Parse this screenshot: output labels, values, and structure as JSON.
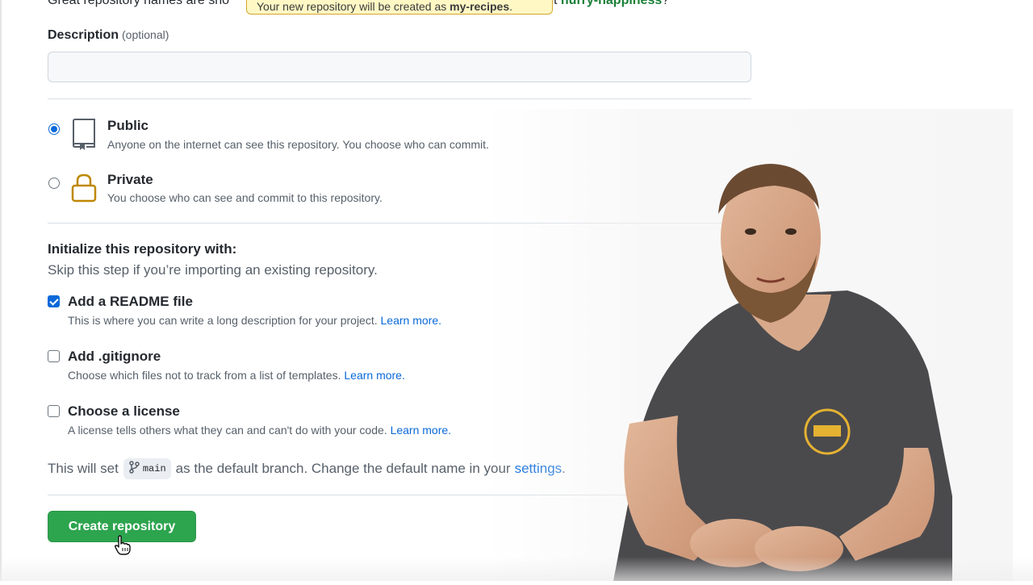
{
  "top": {
    "partial_text": "Great repository names are sho",
    "suffix_prefix": "t ",
    "suffix_name": "hurry-happiness",
    "suffix_end": "?",
    "tooltip_prefix": "Your new repository will be created as ",
    "tooltip_repo": "my-recipes",
    "tooltip_end": "."
  },
  "description": {
    "label": "Description",
    "optional": "(optional)",
    "value": "",
    "placeholder": ""
  },
  "visibility": {
    "options": [
      {
        "title": "Public",
        "desc": "Anyone on the internet can see this repository. You choose who can commit.",
        "selected": true,
        "icon": "repo-icon"
      },
      {
        "title": "Private",
        "desc": "You choose who can see and commit to this repository.",
        "selected": false,
        "icon": "lock-icon"
      }
    ]
  },
  "initialize": {
    "title": "Initialize this repository with:",
    "subtitle": "Skip this step if you’re importing an existing repository.",
    "options": [
      {
        "title": "Add a README file",
        "desc": "This is where you can write a long description for your project.",
        "link": "Learn more.",
        "checked": true
      },
      {
        "title": "Add .gitignore",
        "desc": "Choose which files not to track from a list of templates.",
        "link": "Learn more.",
        "checked": false
      },
      {
        "title": "Choose a license",
        "desc": "A license tells others what they can and can't do with your code.",
        "link": "Learn more.",
        "checked": false
      }
    ]
  },
  "branch": {
    "prefix": "This will set",
    "name": "main",
    "middle": "as the default branch. Change the default name in your",
    "link": "settings",
    "end": "."
  },
  "create_button": "Create repository",
  "colors": {
    "primary_green": "#2da44e",
    "link_blue": "#0969da",
    "tooltip_bg": "#fff8c5"
  }
}
